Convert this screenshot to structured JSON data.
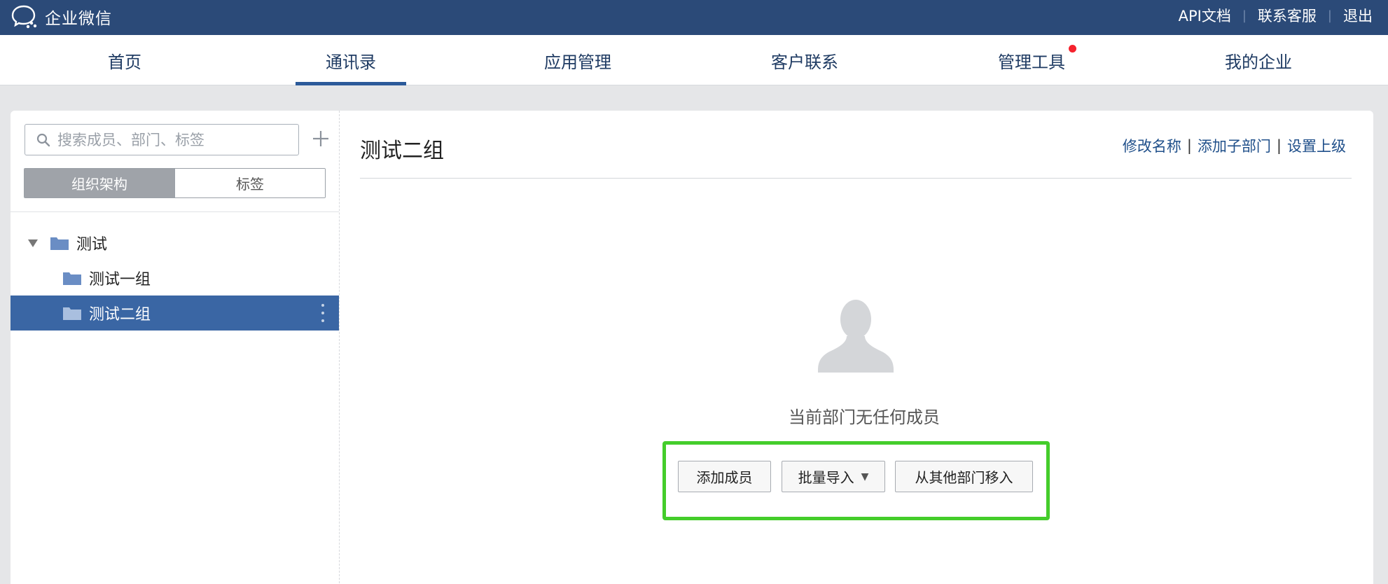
{
  "app": {
    "brand": "企业微信"
  },
  "top_links": {
    "api_docs": "API文档",
    "support": "联系客服",
    "logout": "退出"
  },
  "nav": {
    "items": [
      {
        "label": "首页"
      },
      {
        "label": "通讯录",
        "active": true
      },
      {
        "label": "应用管理"
      },
      {
        "label": "客户联系"
      },
      {
        "label": "管理工具",
        "badge": true
      },
      {
        "label": "我的企业"
      }
    ]
  },
  "sidebar": {
    "search_placeholder": "搜索成员、部门、标签",
    "tabs": {
      "org": "组织架构",
      "tags": "标签"
    },
    "tree": [
      {
        "label": "测试",
        "level": 0,
        "expanded": true
      },
      {
        "label": "测试一组",
        "level": 1
      },
      {
        "label": "测试二组",
        "level": 1,
        "selected": true
      }
    ]
  },
  "main": {
    "title": "测试二组",
    "actions": {
      "rename": "修改名称",
      "add_sub": "添加子部门",
      "set_parent": "设置上级"
    },
    "empty_text": "当前部门无任何成员",
    "buttons": {
      "add_member": "添加成员",
      "batch_import": "批量导入",
      "move_from": "从其他部门移入"
    }
  },
  "colors": {
    "topbar": "#2b4a78",
    "selected_row": "#3a66a4",
    "highlight": "#44cd2b",
    "badge": "#f5222d"
  }
}
